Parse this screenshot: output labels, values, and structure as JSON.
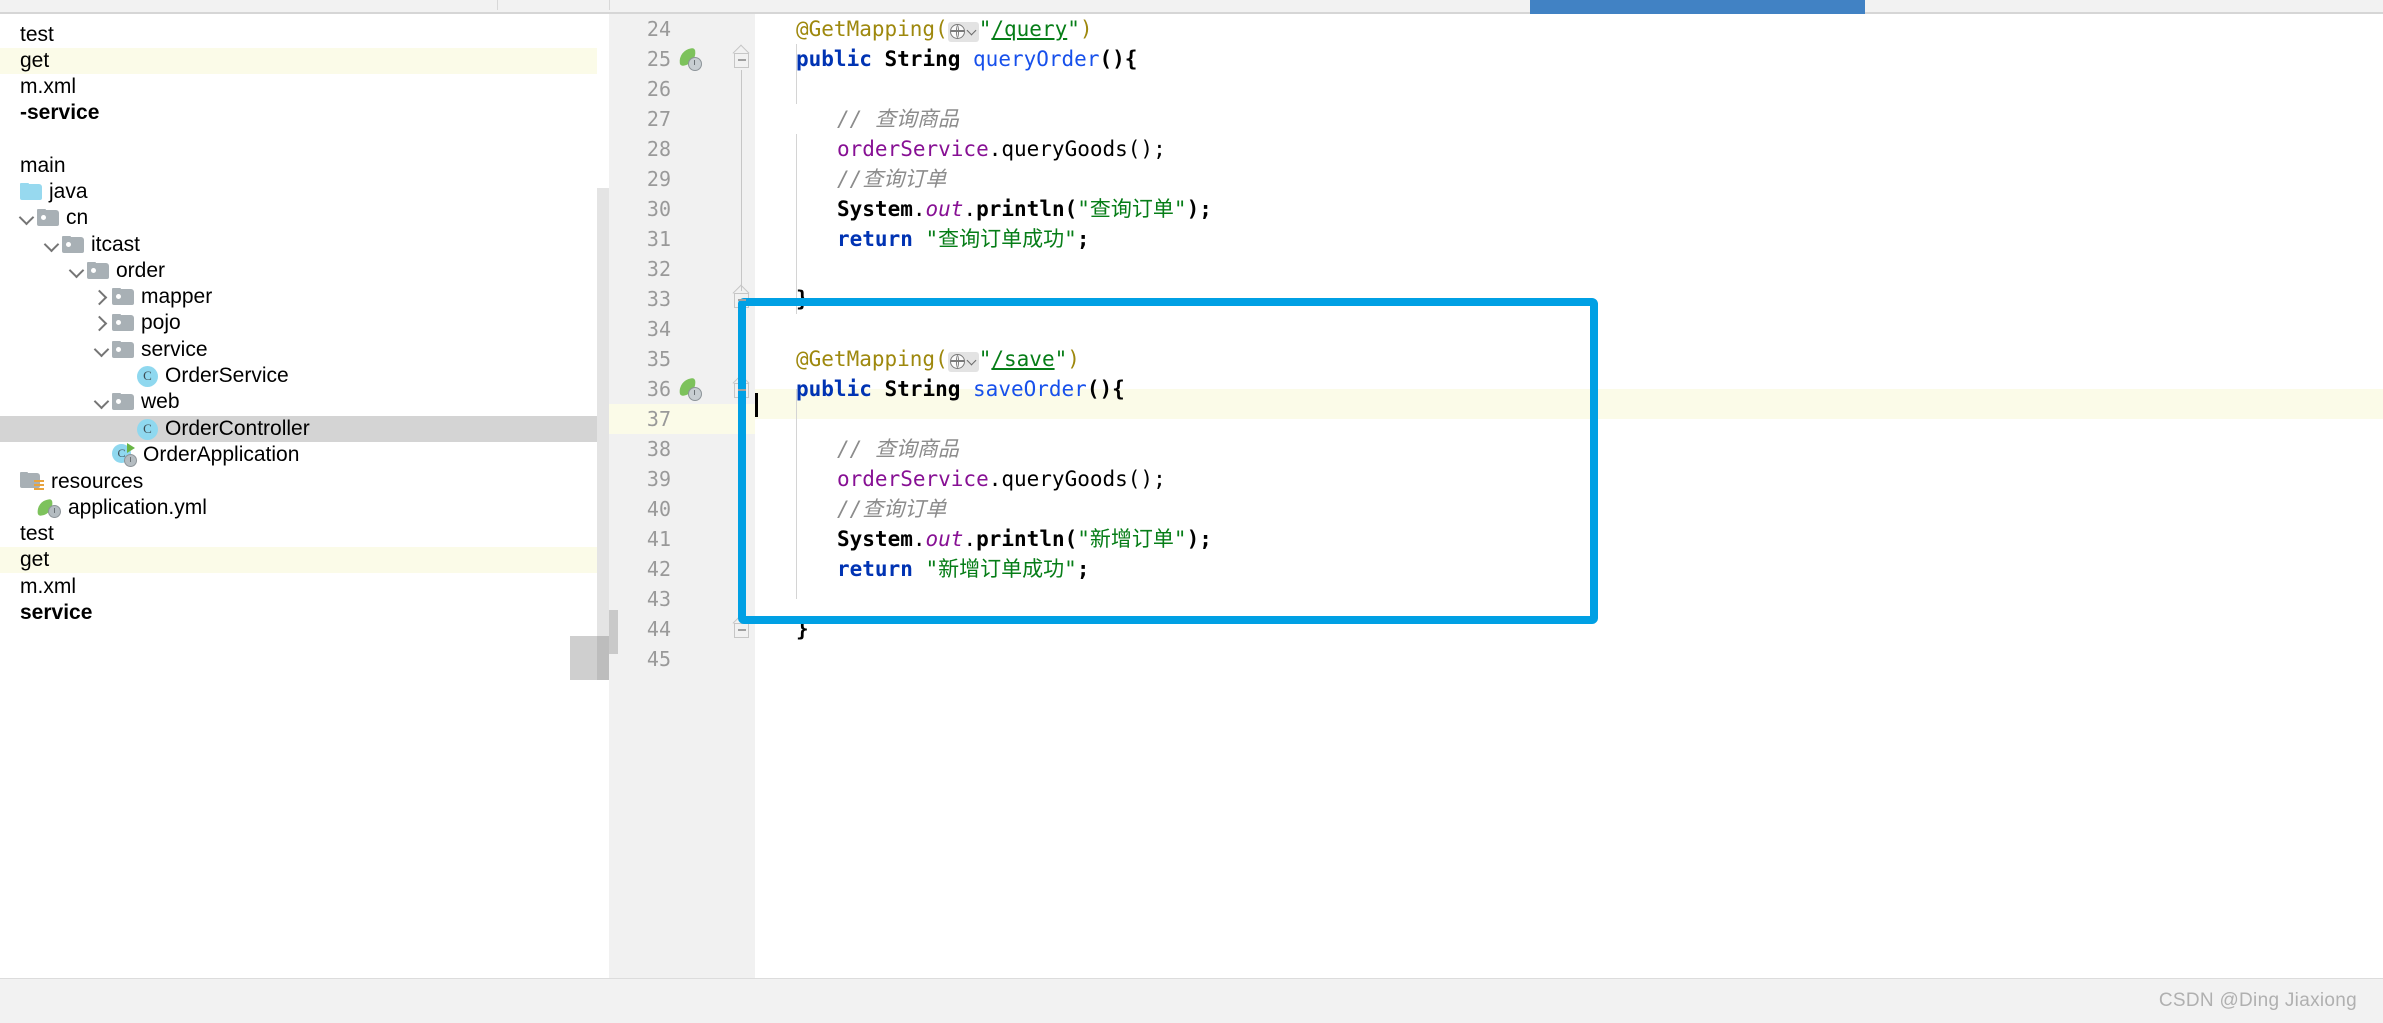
{
  "tabbar": {
    "active_tab_accent": "#4182c4"
  },
  "sidebar": {
    "tree": [
      {
        "label": "test",
        "indent": 0,
        "icon": "none",
        "state": "normal",
        "chevron": "none"
      },
      {
        "label": "get",
        "indent": 0,
        "icon": "none",
        "state": "modified",
        "chevron": "none"
      },
      {
        "label": "m.xml",
        "indent": 0,
        "icon": "none",
        "state": "normal",
        "chevron": "none"
      },
      {
        "label": "-service",
        "indent": 0,
        "icon": "none",
        "state": "bold",
        "chevron": "none"
      },
      {
        "label": "main",
        "indent": 0,
        "icon": "none",
        "state": "normal",
        "chevron": "none"
      },
      {
        "label": "java",
        "indent": 0,
        "icon": "folder-blue",
        "state": "normal",
        "chevron": "none"
      },
      {
        "label": "cn",
        "indent": 1,
        "icon": "folder-grey",
        "state": "normal",
        "chevron": "down"
      },
      {
        "label": "itcast",
        "indent": 2,
        "icon": "folder-grey",
        "state": "normal",
        "chevron": "down"
      },
      {
        "label": "order",
        "indent": 3,
        "icon": "folder-grey",
        "state": "normal",
        "chevron": "down"
      },
      {
        "label": "mapper",
        "indent": 4,
        "icon": "folder-grey",
        "state": "normal",
        "chevron": "right"
      },
      {
        "label": "pojo",
        "indent": 4,
        "icon": "folder-grey",
        "state": "normal",
        "chevron": "right"
      },
      {
        "label": "service",
        "indent": 4,
        "icon": "folder-grey",
        "state": "normal",
        "chevron": "down"
      },
      {
        "label": "OrderService",
        "indent": 5,
        "icon": "class",
        "state": "normal",
        "chevron": "none"
      },
      {
        "label": "web",
        "indent": 4,
        "icon": "folder-grey",
        "state": "normal",
        "chevron": "down"
      },
      {
        "label": "OrderController",
        "indent": 5,
        "icon": "class",
        "state": "selected",
        "chevron": "none"
      },
      {
        "label": "OrderApplication",
        "indent": 4,
        "icon": "springboot",
        "state": "normal",
        "chevron": "none"
      },
      {
        "label": "resources",
        "indent": 0,
        "icon": "folder-res",
        "state": "normal",
        "chevron": "none"
      },
      {
        "label": "application.yml",
        "indent": 1,
        "icon": "yml",
        "state": "normal",
        "chevron": "none"
      },
      {
        "label": "test",
        "indent": 0,
        "icon": "none",
        "state": "normal",
        "chevron": "none"
      },
      {
        "label": "get",
        "indent": 0,
        "icon": "none",
        "state": "modified",
        "chevron": "none"
      },
      {
        "label": "m.xml",
        "indent": 0,
        "icon": "none",
        "state": "normal",
        "chevron": "none"
      },
      {
        "label": "service",
        "indent": 0,
        "icon": "none",
        "state": "bold",
        "chevron": "none"
      }
    ]
  },
  "editor": {
    "file_language": "java",
    "first_line": 24,
    "last_line": 45,
    "current_line": 37,
    "run_gutter_lines": [
      25,
      36
    ],
    "fold_lines": [
      25,
      33,
      36,
      44
    ],
    "lines": [
      {
        "n": 24,
        "text": "    @GetMapping(\"/query\")"
      },
      {
        "n": 25,
        "text": "    public String queryOrder(){"
      },
      {
        "n": 26,
        "text": ""
      },
      {
        "n": 27,
        "text": "        // 查询商品"
      },
      {
        "n": 28,
        "text": "        orderService.queryGoods();"
      },
      {
        "n": 29,
        "text": "        //查询订单"
      },
      {
        "n": 30,
        "text": "        System.out.println(\"查询订单\");"
      },
      {
        "n": 31,
        "text": "        return \"查询订单成功\";"
      },
      {
        "n": 32,
        "text": ""
      },
      {
        "n": 33,
        "text": "    }"
      },
      {
        "n": 34,
        "text": ""
      },
      {
        "n": 35,
        "text": "    @GetMapping(\"/save\")"
      },
      {
        "n": 36,
        "text": "    public String saveOrder(){"
      },
      {
        "n": 37,
        "text": ""
      },
      {
        "n": 38,
        "text": "        // 查询商品"
      },
      {
        "n": 39,
        "text": "        orderService.queryGoods();"
      },
      {
        "n": 40,
        "text": "        //查询订单"
      },
      {
        "n": 41,
        "text": "        System.out.println(\"新增订单\");"
      },
      {
        "n": 42,
        "text": "        return \"新增订单成功\";"
      },
      {
        "n": 43,
        "text": ""
      },
      {
        "n": 44,
        "text": "    }"
      },
      {
        "n": 45,
        "text": ""
      }
    ],
    "tokens": {
      "annotation_getmapping": "@GetMapping",
      "url_query": "/query",
      "url_save": "/save",
      "kw_public": "public",
      "kw_return": "return",
      "type_string": "String",
      "method_queryOrder": "queryOrder",
      "method_saveOrder": "saveOrder",
      "field_orderService": "orderService",
      "call_queryGoods": "queryGoods",
      "class_System": "System",
      "static_out": "out",
      "call_println": "println",
      "comment_goods": "// 查询商品",
      "comment_order": "//查询订单",
      "str_query_order": "查询订单",
      "str_query_order_ok": "查询订单成功",
      "str_new_order": "新增订单",
      "str_new_order_ok": "新增订单成功",
      "brace_close": "}",
      "paren_open": "(",
      "paren_close": ")",
      "brace_open": "{",
      "semi": ";",
      "dot": ".",
      "quote": "\"",
      "empty_parens": "()"
    },
    "annotation_highlight": {
      "color": "#00a0e4",
      "covers_lines": "34-45"
    }
  },
  "statusbar": {
    "watermark": "CSDN @Ding Jiaxiong"
  }
}
